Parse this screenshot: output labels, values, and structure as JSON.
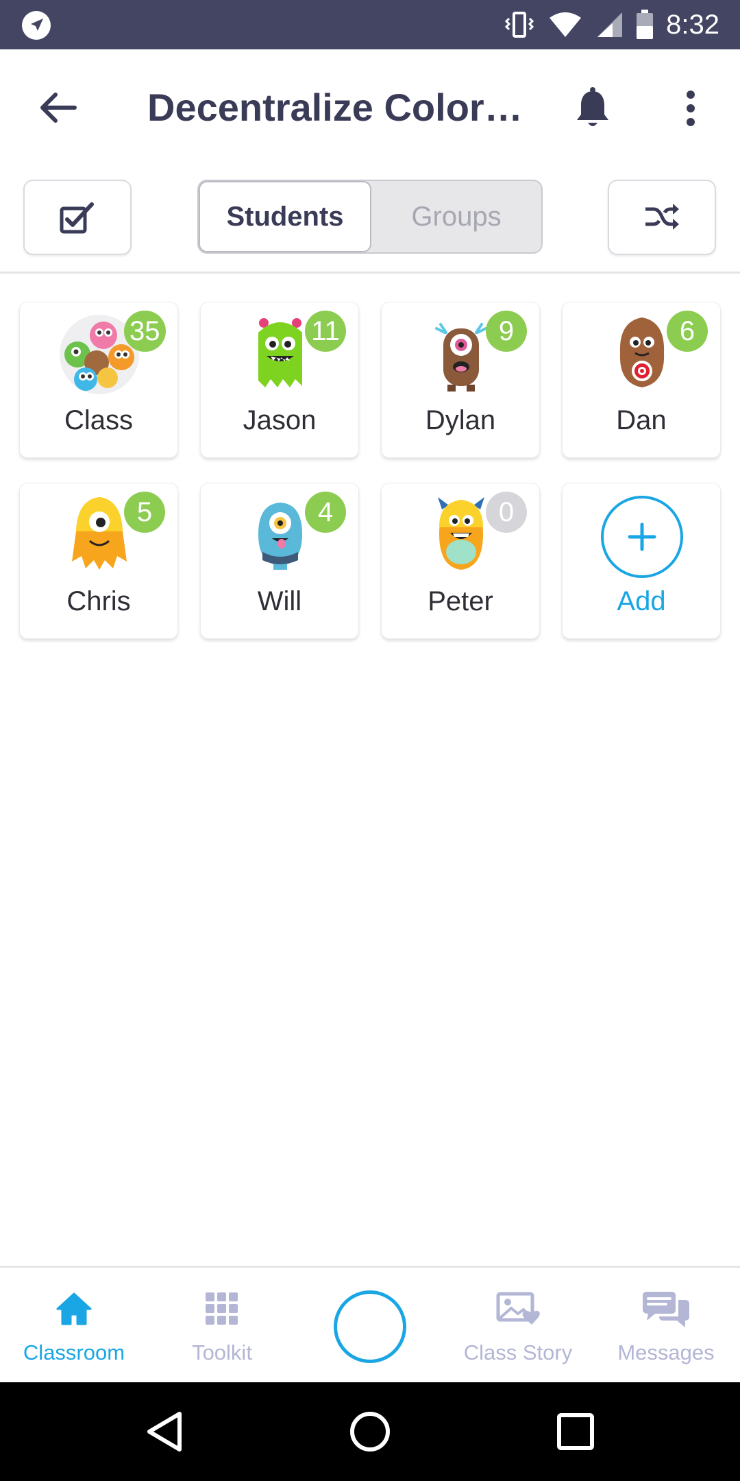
{
  "status_bar": {
    "time": "8:32",
    "icons": [
      "navigation-icon",
      "vibrate-icon",
      "wifi-icon",
      "cell-signal-icon",
      "battery-icon"
    ]
  },
  "header": {
    "title": "Decentralize Color…",
    "icons": [
      "back-arrow-icon",
      "bell-icon",
      "more-vert-icon"
    ]
  },
  "toolbar": {
    "segments": {
      "students": "Students",
      "groups": "Groups"
    },
    "selected_segment": "Students",
    "icons": [
      "checkbox-edit-icon",
      "shuffle-icon"
    ]
  },
  "cards": [
    {
      "name": "Class",
      "points": "35",
      "avatar": "class-group-icon"
    },
    {
      "name": "Jason",
      "points": "11",
      "avatar": "green-monster-icon"
    },
    {
      "name": "Dylan",
      "points": "9",
      "avatar": "brown-cyclops-monster-icon"
    },
    {
      "name": "Dan",
      "points": "6",
      "avatar": "brown-furry-monster-icon"
    },
    {
      "name": "Chris",
      "points": "5",
      "avatar": "orange-cyclops-monster-icon"
    },
    {
      "name": "Will",
      "points": "4",
      "avatar": "blue-cyclops-monster-icon"
    },
    {
      "name": "Peter",
      "points": "0",
      "avatar": "orange-horned-monster-icon"
    }
  ],
  "add_card": {
    "label": "Add"
  },
  "bottom_nav": [
    {
      "label": "Classroom",
      "icon": "home-icon",
      "active": true
    },
    {
      "label": "Toolkit",
      "icon": "grid-icon",
      "active": false
    },
    {
      "label": "",
      "icon": "center-ring-icon",
      "active": false
    },
    {
      "label": "Class Story",
      "icon": "photo-heart-icon",
      "active": false
    },
    {
      "label": "Messages",
      "icon": "chat-bubbles-icon",
      "active": false
    }
  ],
  "colors": {
    "status_bar": "#444563",
    "title_text": "#3a3b57",
    "accent_blue": "#1aa6e4",
    "badge_green": "#8ccc50",
    "badge_zero": "#d6d6da",
    "nav_inactive": "#b3b6d4"
  }
}
